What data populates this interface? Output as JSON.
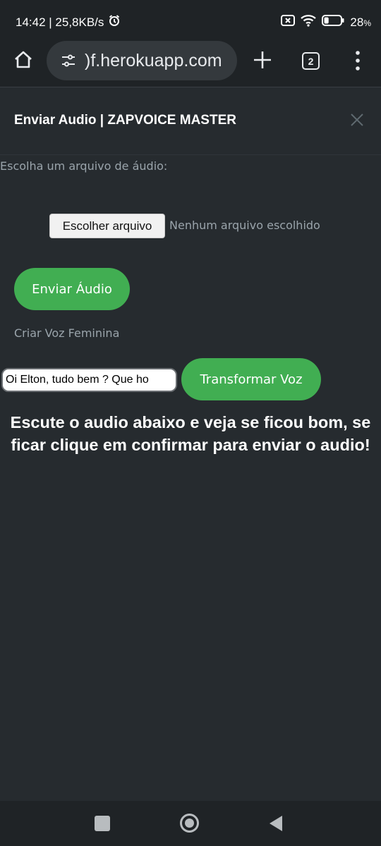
{
  "status_bar": {
    "time_speed": "14:42 | 25,8KB/s",
    "battery_percent": "28",
    "battery_level": 0.28,
    "icons": [
      "alarm-icon",
      "sim-error-icon",
      "wifi-icon",
      "battery-icon"
    ]
  },
  "browser": {
    "url": ")f.herokuapp.com",
    "tab_count": "2",
    "icons": [
      "home-icon",
      "site-settings-icon",
      "new-tab-icon",
      "tabs-icon",
      "menu-icon"
    ]
  },
  "modal": {
    "title": "Enviar Audio | ZAPVOICE MASTER",
    "close_icon": "close-icon"
  },
  "form": {
    "choose_label": "Escolha um arquivo de áudio:",
    "file_button": "Escolher arquivo",
    "file_status": "Nenhum arquivo escolhido",
    "send_button": "Enviar Áudio",
    "female_voice_label": "Criar Voz Feminina",
    "voice_text_value": "Oi Elton, tudo bem ? Que ho",
    "transform_button": "Transformar Voz",
    "instruction": "Escute o audio abaixo e veja se ficou bom, se ficar clique em confirmar para enviar o audio!"
  },
  "colors": {
    "background": "#262b2f",
    "bar_background": "#1f2326",
    "accent_green": "#41ae52",
    "muted_text": "#9aa4ab"
  },
  "nav_bar": {
    "icons": [
      "recents-icon",
      "home-circle-icon",
      "back-icon"
    ]
  }
}
